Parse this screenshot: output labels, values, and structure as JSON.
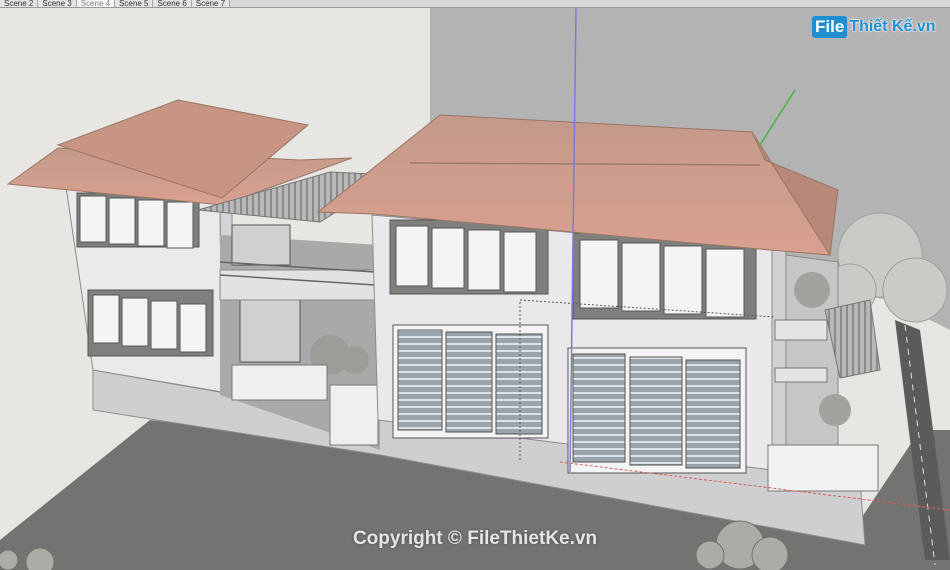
{
  "scene_tabs": [
    "Scene 2",
    "Scene 3",
    "Scene 4",
    "Scene 5",
    "Scene 6",
    "Scene 7"
  ],
  "active_scene_index": 2,
  "watermark": {
    "logo_file": "File",
    "logo_brand": "Thiết Kế.vn",
    "copyright": "Copyright © FileThietKe.vn"
  },
  "colors": {
    "roof": "#c99a88",
    "wall": "#e9e9ec",
    "ground": "#717170",
    "background": "#e6e6e2",
    "axis_blue": "#7c7ad8",
    "axis_green": "#4ab24a",
    "axis_red": "#d86060"
  }
}
